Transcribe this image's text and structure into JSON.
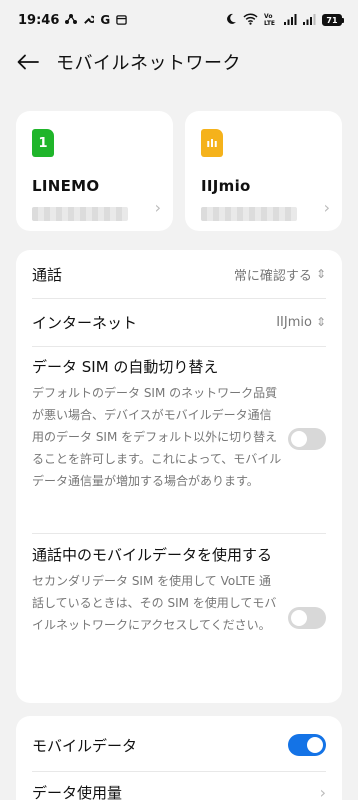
{
  "status_bar": {
    "time": "19:46",
    "left_icons": [
      "network-share-icon",
      "wrench-icon",
      "google-icon",
      "calendar-icon"
    ],
    "google_glyph": "G",
    "right_icons": [
      "moon-icon",
      "wifi-icon",
      "volte-icon",
      "signal-icon",
      "signal-icon-2"
    ],
    "volte_text": "Vo LTE",
    "battery": "71"
  },
  "header": {
    "title": "モバイルネットワーク"
  },
  "sims": [
    {
      "name": "LINEMO",
      "icon_text": "1",
      "color": "#1fb52a"
    },
    {
      "name": "IIJmio",
      "icon_text": "ılı",
      "color": "#f5b21b"
    }
  ],
  "settings": {
    "call": {
      "label": "通話",
      "value": "常に確認する"
    },
    "internet": {
      "label": "インターネット",
      "value": "IIJmio"
    },
    "auto_switch": {
      "title": "データ SIM の自動切り替え",
      "desc": "デフォルトのデータ SIM のネットワーク品質が悪い場合、デバイスがモバイルデータ通信用のデータ SIM をデフォルト以外に切り替えることを許可します。これによって、モバイルデータ通信量が増加する場合があります。",
      "enabled": false
    },
    "call_data": {
      "title": "通話中のモバイルデータを使用する",
      "desc": "セカンダリデータ SIM を使用して VoLTE 通話しているときは、その SIM を使用してモバイルネットワークにアクセスしてください。",
      "enabled": false
    }
  },
  "data_section": {
    "mobile_data": {
      "label": "モバイルデータ",
      "enabled": true
    },
    "data_usage": {
      "label": "データ使用量"
    }
  },
  "colors": {
    "toggle_on": "#1473e6",
    "toggle_off": "#d8d8d8",
    "background": "#f2f2f2"
  }
}
